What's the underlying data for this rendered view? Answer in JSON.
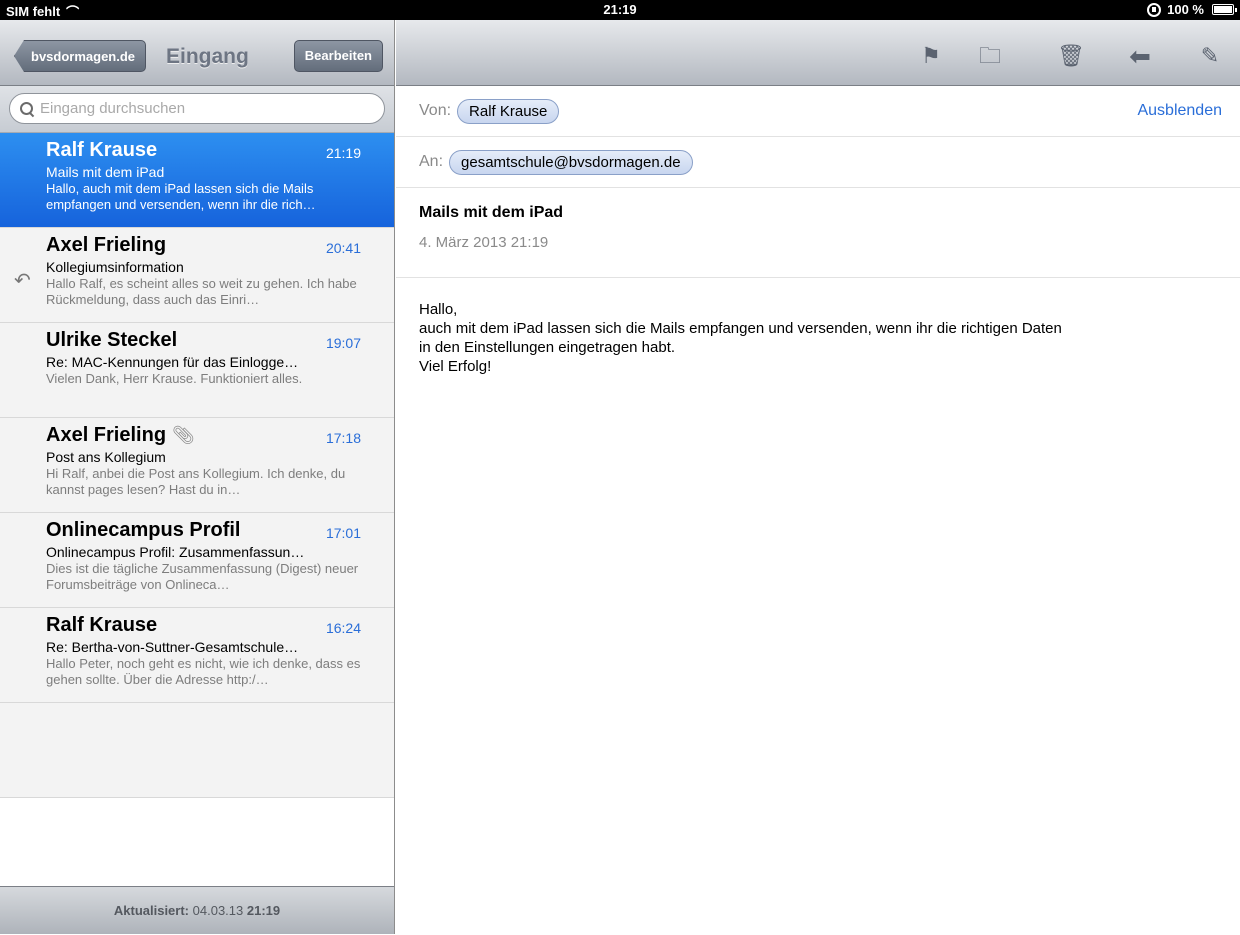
{
  "status_bar": {
    "carrier": "SIM fehlt",
    "time": "21:19",
    "battery": "100 %"
  },
  "left": {
    "back_label": "bvsdormagen.de",
    "title": "Eingang",
    "edit_label": "Bearbeiten",
    "search_placeholder": "Eingang durchsuchen",
    "messages": [
      {
        "sender": "Ralf Krause",
        "time": "21:19",
        "subject": "Mails mit dem iPad",
        "preview": "Hallo, auch mit dem iPad lassen sich die Mails empfangen und versenden, wenn ihr die rich…"
      },
      {
        "sender": "Axel Frieling",
        "time": "20:41",
        "subject": "Kollegiumsinformation",
        "preview": "Hallo Ralf, es scheint alles so weit zu gehen. Ich habe Rückmeldung, dass auch das Einri…"
      },
      {
        "sender": "Ulrike Steckel",
        "time": "19:07",
        "subject": "Re: MAC-Kennungen für das Einlogge…",
        "preview": "Vielen Dank, Herr Krause. Funktioniert alles."
      },
      {
        "sender": "Axel Frieling",
        "time": "17:18",
        "subject": "Post ans Kollegium",
        "preview": "Hi Ralf, anbei die Post ans Kollegium. Ich denke, du kannst pages lesen? Hast du in…"
      },
      {
        "sender": "Onlinecampus Profil",
        "time": "17:01",
        "subject": "Onlinecampus Profil: Zusammenfassun…",
        "preview": "Dies ist die tägliche Zusammenfassung (Digest) neuer Forumsbeiträge von Onlineca…"
      },
      {
        "sender": "Ralf Krause",
        "time": "16:24",
        "subject": "Re: Bertha-von-Suttner-Gesamtschule…",
        "preview": "Hallo Peter, noch geht es nicht, wie ich denke, dass es gehen sollte. Über die Adresse http:/…"
      }
    ],
    "updated_label": "Aktualisiert:",
    "updated_date": "04.03.13",
    "updated_time": "21:19"
  },
  "right": {
    "from_label": "Von:",
    "from": "Ralf Krause",
    "hide_label": "Ausblenden",
    "to_label": "An:",
    "to": "gesamtschule@bvsdormagen.de",
    "subject": "Mails mit dem iPad",
    "date": "4. März 2013 21:19",
    "body": [
      "Hallo,",
      "auch mit dem iPad lassen sich die Mails empfangen und versenden, wenn ihr die richtigen Daten",
      "in den Einstellungen eingetragen habt.",
      "Viel Erfolg!"
    ]
  }
}
